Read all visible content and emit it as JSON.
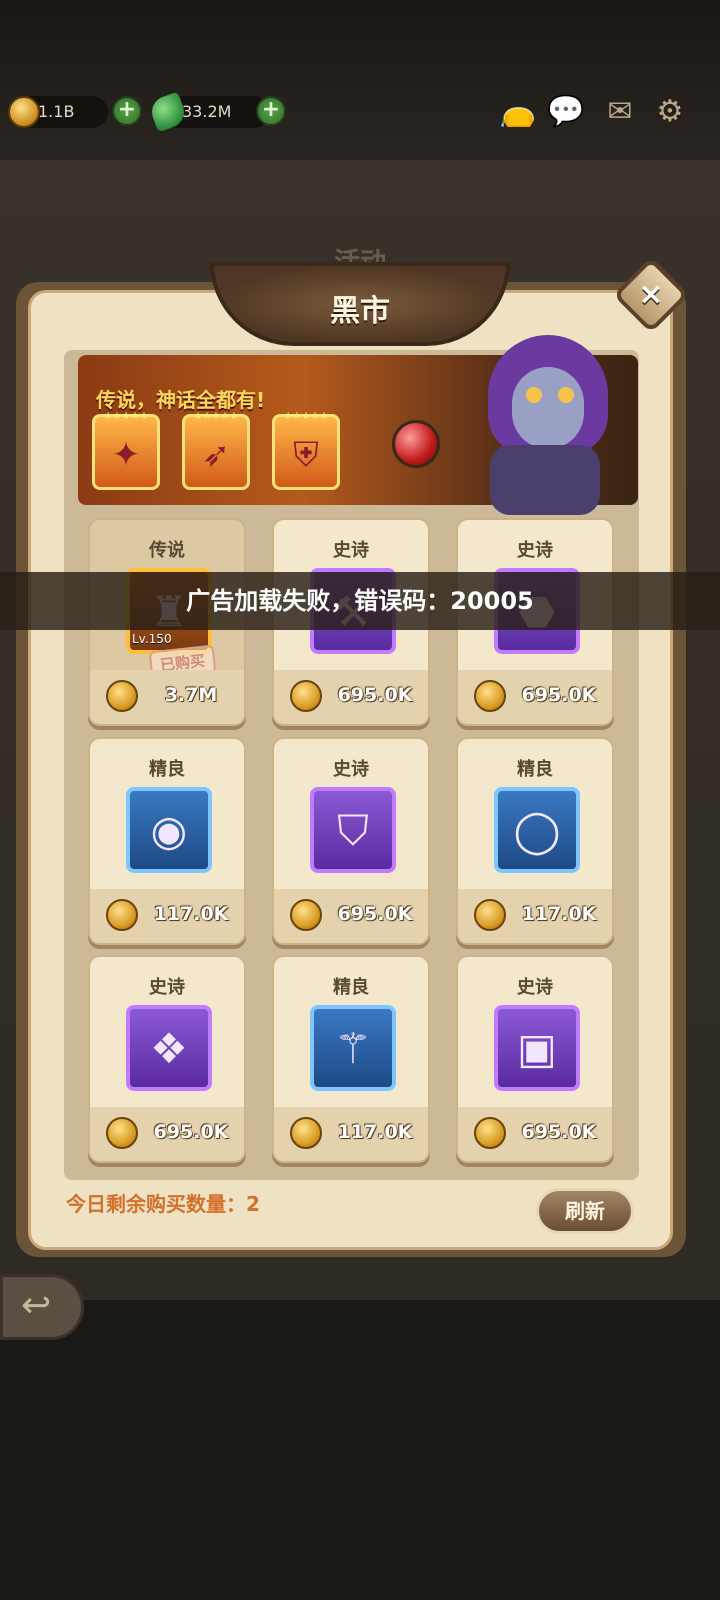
{
  "top": {
    "gold": "1.1B",
    "gems": "33.2M",
    "icons": [
      "bag-icon",
      "chat-icon",
      "mail-icon",
      "settings-icon"
    ]
  },
  "panel": {
    "subtitle": "活动",
    "title": "黑市",
    "close": "×"
  },
  "banner": {
    "text": "传说，神话全都有!",
    "items": [
      {
        "name": "staff-icon",
        "glyph": "✦"
      },
      {
        "name": "wings-icon",
        "glyph": "➶"
      },
      {
        "name": "armor-icon",
        "glyph": "⛨"
      }
    ]
  },
  "toast": "广告加载失败，错误码：20005",
  "items": [
    {
      "rarity": "传说",
      "price": "3.7M",
      "box": "legend",
      "glyph": "♜",
      "icon": "armor-icon",
      "lv": "Lv.150",
      "stamp": "已购买",
      "bought": true
    },
    {
      "rarity": "史诗",
      "price": "695.0K",
      "box": "epic",
      "glyph": "⚒",
      "icon": "pickaxe-icon",
      "bought": false
    },
    {
      "rarity": "史诗",
      "price": "695.0K",
      "box": "epic",
      "glyph": "⬣",
      "icon": "boots-icon",
      "bought": false
    },
    {
      "rarity": "精良",
      "price": "117.0K",
      "box": "fine",
      "glyph": "◉",
      "icon": "amulet-icon",
      "bought": false
    },
    {
      "rarity": "史诗",
      "price": "695.0K",
      "box": "epic",
      "glyph": "⛉",
      "icon": "chestplate-icon",
      "bought": false
    },
    {
      "rarity": "精良",
      "price": "117.0K",
      "box": "fine",
      "glyph": "◯",
      "icon": "ring-icon",
      "bought": false
    },
    {
      "rarity": "史诗",
      "price": "695.0K",
      "box": "epic",
      "glyph": "❖",
      "icon": "gem-necklace-icon",
      "bought": false
    },
    {
      "rarity": "精良",
      "price": "117.0K",
      "box": "fine",
      "glyph": "⚚",
      "icon": "torch-staff-icon",
      "bought": false
    },
    {
      "rarity": "史诗",
      "price": "695.0K",
      "box": "epic",
      "glyph": "▣",
      "icon": "helmet-icon",
      "bought": false
    }
  ],
  "footer": {
    "remaining": "今日剩余购买数量：2",
    "refresh": "刷新"
  }
}
